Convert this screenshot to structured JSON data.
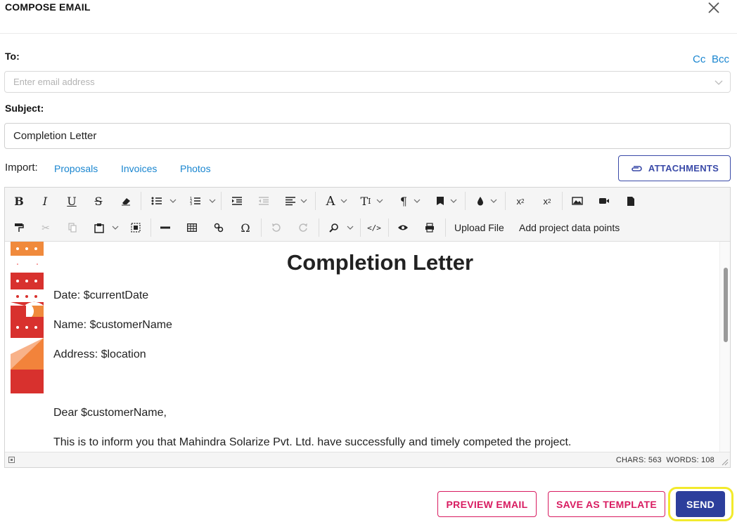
{
  "header": {
    "title": "COMPOSE EMAIL",
    "close_icon": "close-icon"
  },
  "to": {
    "label": "To:",
    "placeholder": "Enter email address",
    "value": ""
  },
  "cc_bcc": {
    "cc": "Cc",
    "bcc": "Bcc"
  },
  "subject": {
    "label": "Subject:",
    "value": "Completion Letter"
  },
  "import": {
    "label": "Import:",
    "links": [
      "Proposals",
      "Invoices",
      "Photos"
    ]
  },
  "attachments": {
    "label": "ATTACHMENTS",
    "icon": "paperclip-icon"
  },
  "toolbar": {
    "row1_icons": [
      "bold-icon",
      "italic-icon",
      "underline-icon",
      "strikethrough-icon",
      "eraser-icon",
      "bullet-list-icon",
      "numbered-list-icon",
      "indent-icon",
      "outdent-icon",
      "align-icon",
      "font-family-icon",
      "font-size-icon",
      "paragraph-icon",
      "format-block-icon",
      "color-icon",
      "superscript-icon",
      "subscript-icon",
      "image-icon",
      "video-icon",
      "file-icon"
    ],
    "row2_icons": [
      "paint-format-icon",
      "cut-icon",
      "copy-icon",
      "paste-icon",
      "select-all-icon",
      "horizontal-line-icon",
      "table-icon",
      "link-icon",
      "omega-icon",
      "undo-icon",
      "redo-icon",
      "find-icon",
      "code-view-icon",
      "preview-icon",
      "print-icon"
    ],
    "upload_file": "Upload File",
    "add_data_points": "Add project data points"
  },
  "document": {
    "heading": "Completion Letter",
    "date_line": "Date: $currentDate",
    "name_line": "Name: $customerName",
    "address_line": "Address: $location",
    "greeting": "Dear $customerName,",
    "body": "This is to inform you that Mahindra Solarize Pvt. Ltd. have successfully and timely competed the project."
  },
  "status": {
    "chars": "CHARS: 563",
    "words": "WORDS: 108"
  },
  "actions": {
    "preview": "PREVIEW EMAIL",
    "save_template": "SAVE AS TEMPLATE",
    "send": "SEND"
  },
  "colors": {
    "link": "#1a86d0",
    "primary": "#2c3e9c",
    "accent_pink": "#d81b60",
    "highlight": "#f2ea2c"
  }
}
